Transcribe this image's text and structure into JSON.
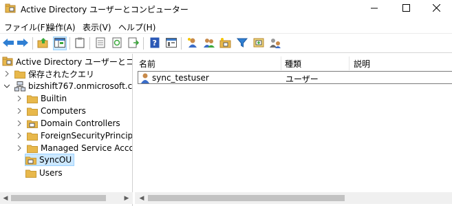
{
  "window": {
    "title": "Active Directory ユーザーとコンピューター",
    "icon": "ad-console-icon"
  },
  "menu": [
    {
      "label": "ファイル(F)"
    },
    {
      "label": "操作(A)"
    },
    {
      "label": "表示(V)"
    },
    {
      "label": "ヘルプ(H)"
    }
  ],
  "toolbar": {
    "buttons": [
      "back-arrow-icon",
      "forward-arrow-icon",
      "up-folder-icon",
      "show-console-tree-icon",
      "clipboard-icon",
      "properties-icon",
      "refresh-icon",
      "export-list-icon",
      "help-icon",
      "console-icon",
      "new-user-icon",
      "new-group-icon",
      "new-ou-icon",
      "filter-icon",
      "add-to-group-icon",
      "delegate-control-icon"
    ]
  },
  "tree": {
    "root": "Active Directory ユーザーとコンピュー",
    "items": [
      {
        "label": "保存されたクエリ",
        "icon": "folder-icon",
        "expander": "collapsed"
      },
      {
        "label": "bizshift767.onmicrosoft.com",
        "icon": "domain-icon",
        "expander": "expanded"
      },
      {
        "label": "Builtin",
        "icon": "folder-icon",
        "expander": "collapsed"
      },
      {
        "label": "Computers",
        "icon": "folder-icon",
        "expander": "collapsed"
      },
      {
        "label": "Domain Controllers",
        "icon": "ou-icon",
        "expander": "collapsed"
      },
      {
        "label": "ForeignSecurityPrincipals",
        "icon": "folder-icon",
        "expander": "collapsed"
      },
      {
        "label": "Managed Service Accoun",
        "icon": "folder-icon",
        "expander": "collapsed"
      },
      {
        "label": "SyncOU",
        "icon": "ou-icon",
        "expander": "none",
        "selected": true
      },
      {
        "label": "Users",
        "icon": "folder-icon",
        "expander": "none"
      }
    ]
  },
  "list": {
    "columns": [
      {
        "label": "名前"
      },
      {
        "label": "種類"
      },
      {
        "label": "説明"
      }
    ],
    "rows": [
      {
        "name": "sync_testuser",
        "type": "ユーザー",
        "description": ""
      }
    ]
  },
  "colors": {
    "selection": "#cce8ff",
    "selection_border": "#99d1ff",
    "folder": "#e8b84b",
    "back_arrow": "#2f7fd3",
    "forward_arrow": "#2f7fd3"
  }
}
